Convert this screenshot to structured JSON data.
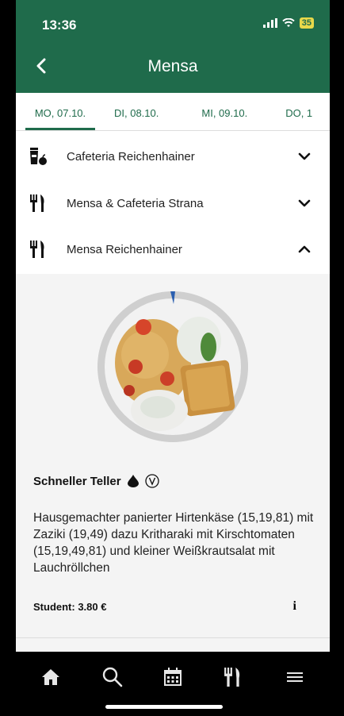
{
  "status": {
    "time": "13:36",
    "battery": "35"
  },
  "header": {
    "title": "Mensa"
  },
  "tabs": [
    {
      "label": "MO, 07.10."
    },
    {
      "label": "DI, 08.10."
    },
    {
      "label": "MI, 09.10."
    },
    {
      "label": "DO, 1"
    }
  ],
  "locations": [
    {
      "label": "Cafeteria Reichenhainer",
      "icon": "coffee-apple-icon",
      "expanded": false
    },
    {
      "label": "Mensa & Cafeteria Strana",
      "icon": "cutlery-icon",
      "expanded": false
    },
    {
      "label": "Mensa Reichenhainer",
      "icon": "cutlery-icon",
      "expanded": true
    }
  ],
  "meal": {
    "name": "Schneller Teller",
    "badges": [
      "drop-icon",
      "vegetarian-v-icon"
    ],
    "description": "Hausgemachter panierter Hirtenkäse (15,19,81) mit Zaziki (19,49) dazu Kritharaki mit Kirschtomaten (15,19,49,81) und kleiner Weißkrautsalat mit Lauchröllchen",
    "price": "Student: 3.80 €",
    "info": "i"
  },
  "nav": [
    "home-icon",
    "search-icon",
    "calendar-icon",
    "cutlery-icon",
    "menu-icon"
  ],
  "colors": {
    "primary": "#1f6b4b",
    "background": "#ffffff",
    "panel": "#f4f4f4",
    "nav": "#000000"
  }
}
